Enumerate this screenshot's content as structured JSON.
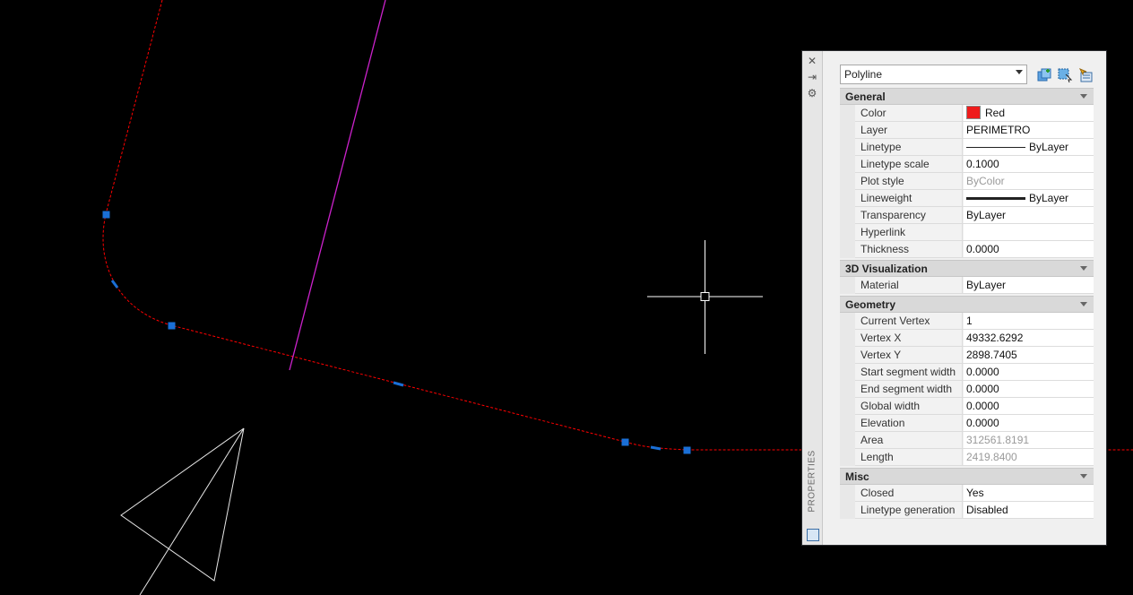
{
  "palette": {
    "side_title": "PROPERTIES",
    "object_type": "Polyline",
    "toolbar": {
      "quick_select_icon": "quick-select-icon",
      "select_objects_icon": "select-objects-icon",
      "pickadd_icon": "pickadd-toggle-icon"
    },
    "sections": {
      "general": {
        "title": "General",
        "color_label": "Color",
        "color_value": "Red",
        "color_hex": "#ee1c1c",
        "layer_label": "Layer",
        "layer_value": "PERIMETRO",
        "linetype_label": "Linetype",
        "linetype_value": "ByLayer",
        "linetype_scale_label": "Linetype scale",
        "linetype_scale_value": "0.1000",
        "plot_style_label": "Plot style",
        "plot_style_value": "ByColor",
        "lineweight_label": "Lineweight",
        "lineweight_value": "ByLayer",
        "transparency_label": "Transparency",
        "transparency_value": "ByLayer",
        "hyperlink_label": "Hyperlink",
        "hyperlink_value": "",
        "thickness_label": "Thickness",
        "thickness_value": "0.0000"
      },
      "visualization": {
        "title": "3D Visualization",
        "material_label": "Material",
        "material_value": "ByLayer"
      },
      "geometry": {
        "title": "Geometry",
        "current_vertex_label": "Current Vertex",
        "current_vertex_value": "1",
        "vertex_x_label": "Vertex X",
        "vertex_x_value": "49332.6292",
        "vertex_y_label": "Vertex Y",
        "vertex_y_value": "2898.7405",
        "start_width_label": "Start segment width",
        "start_width_value": "0.0000",
        "end_width_label": "End segment width",
        "end_width_value": "0.0000",
        "global_width_label": "Global width",
        "global_width_value": "0.0000",
        "elevation_label": "Elevation",
        "elevation_value": "0.0000",
        "area_label": "Area",
        "area_value": "312561.8191",
        "length_label": "Length",
        "length_value": "2419.8400"
      },
      "misc": {
        "title": "Misc",
        "closed_label": "Closed",
        "closed_value": "Yes",
        "linetype_gen_label": "Linetype generation",
        "linetype_gen_value": "Disabled"
      }
    }
  },
  "drawing": {
    "background": "#000000",
    "polyline_color": "#ff0000",
    "magenta_line_color": "#cc22cc",
    "grip_color": "#1a6fd6",
    "crosshair_color": "#ffffff"
  }
}
